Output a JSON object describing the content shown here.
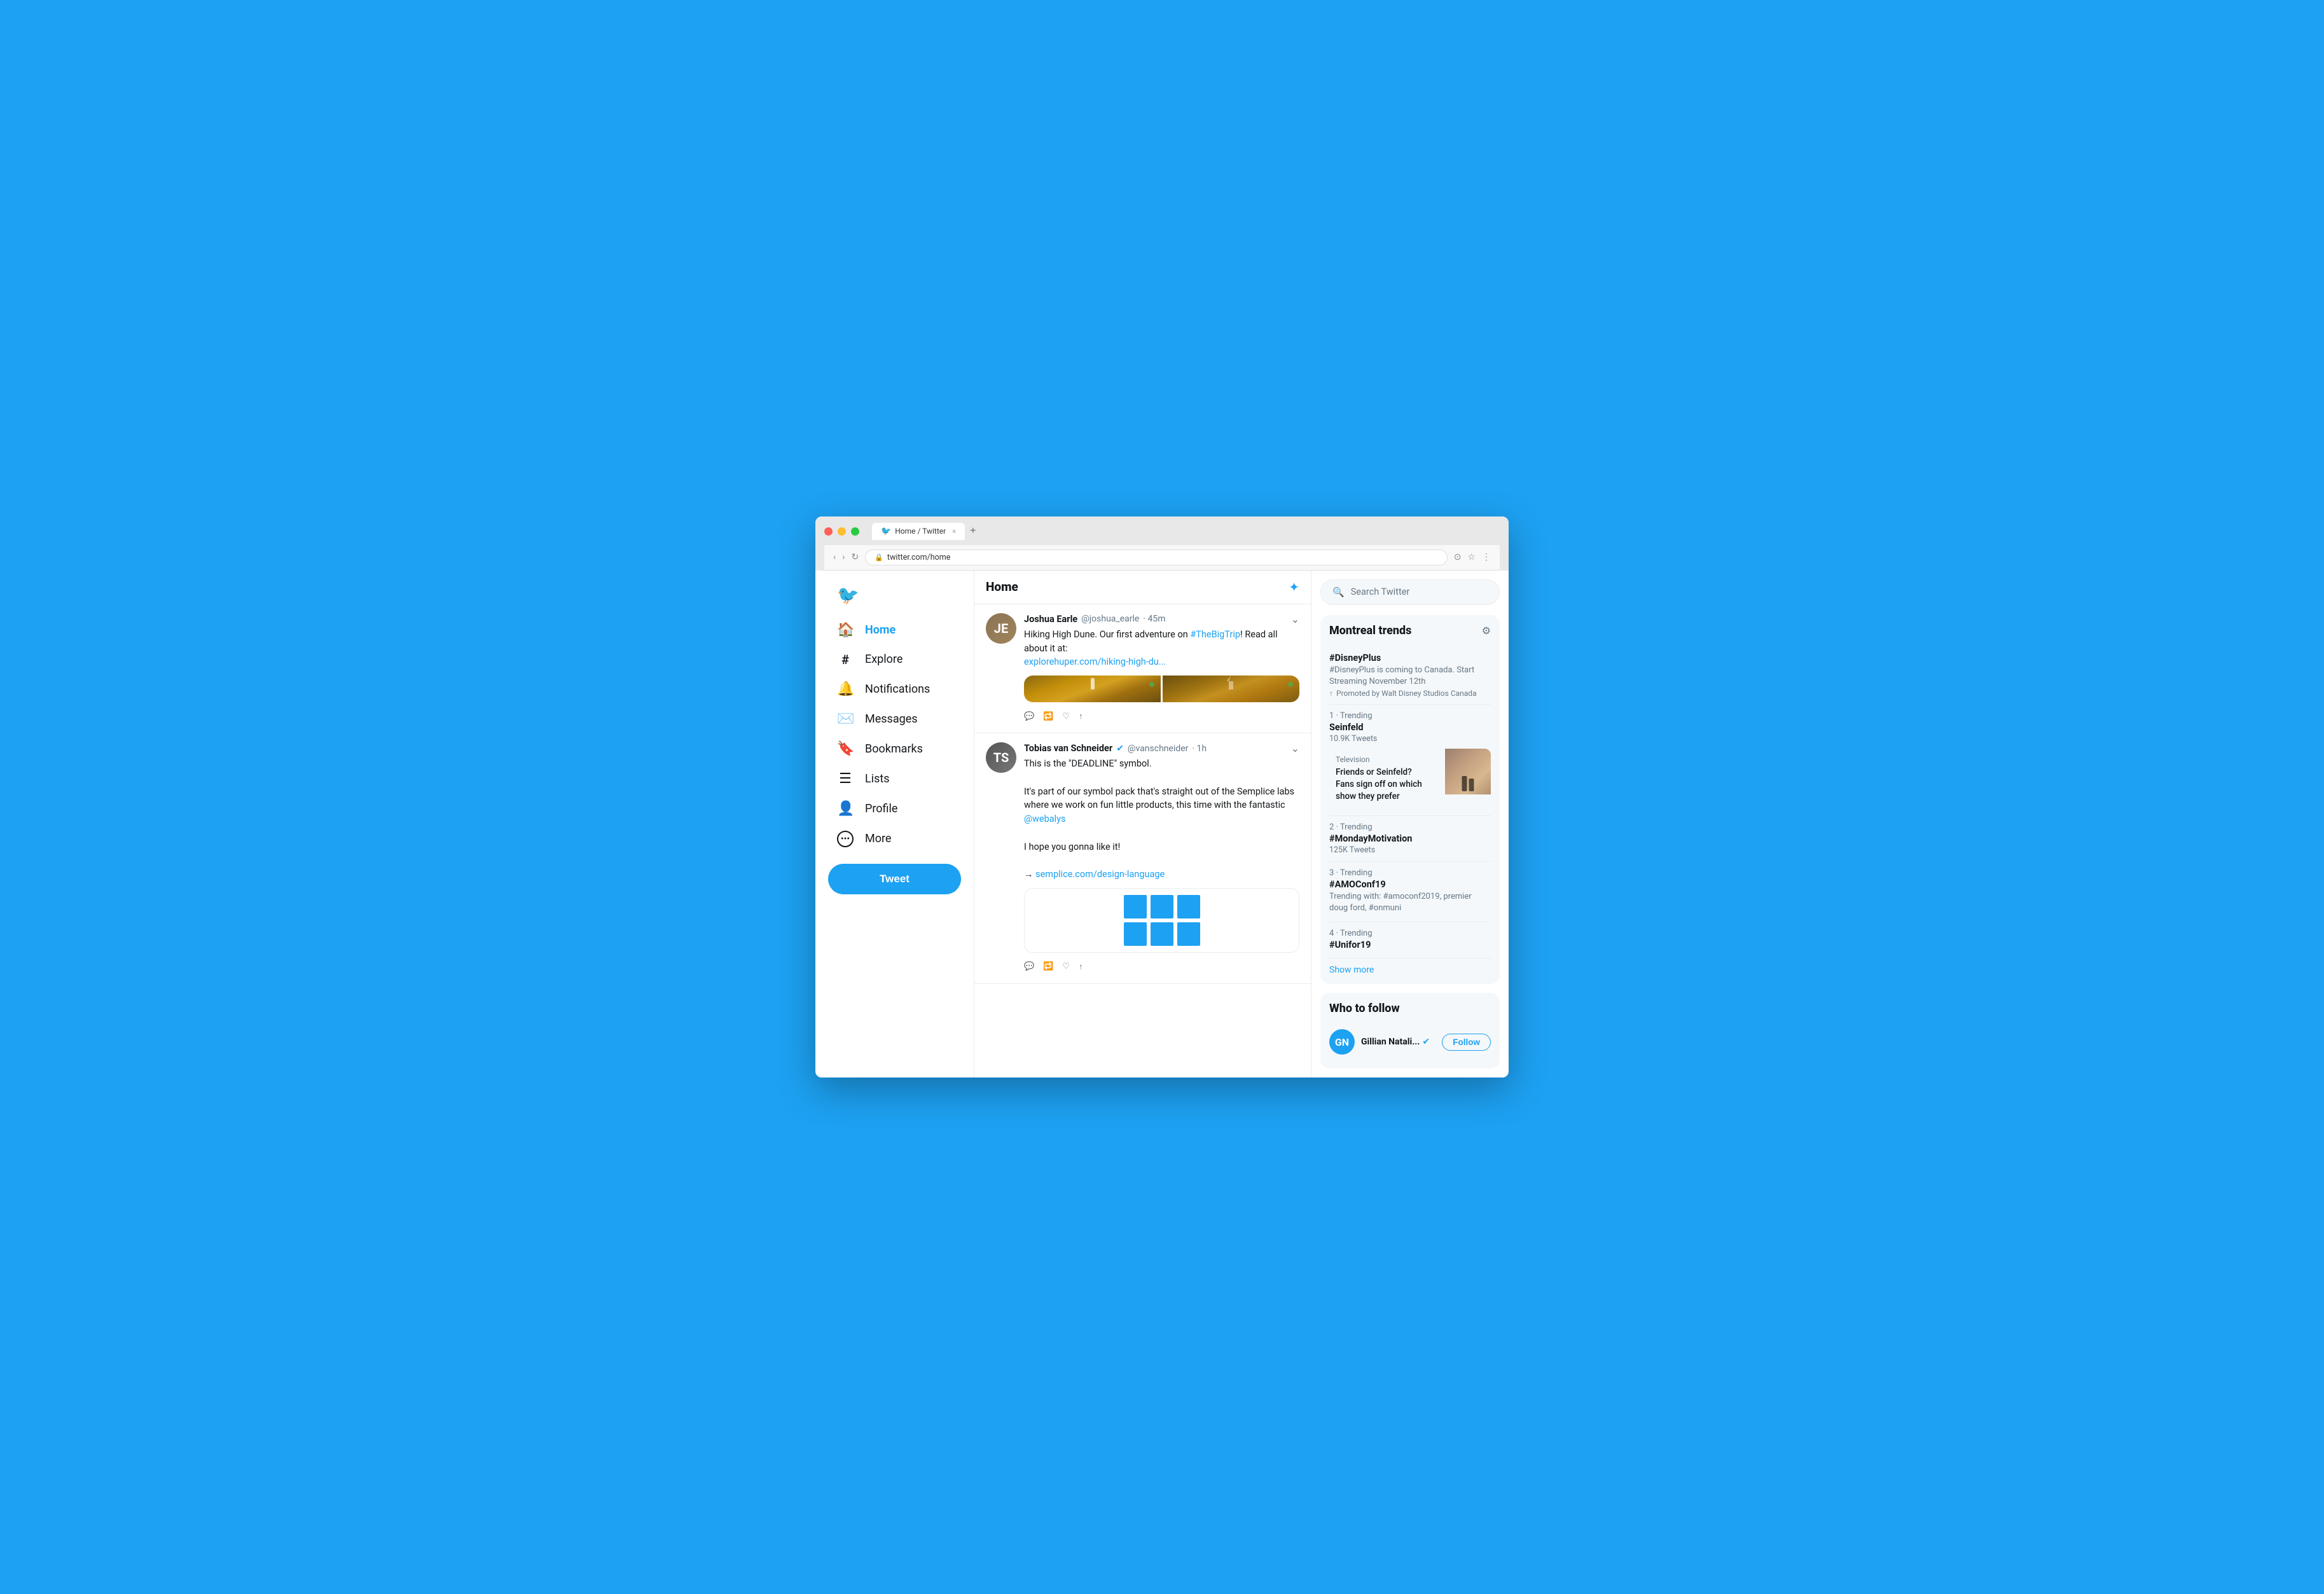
{
  "browser": {
    "traffic_lights": [
      "red",
      "yellow",
      "green"
    ],
    "tab_title": "Home / Twitter",
    "tab_favicon": "🐦",
    "tab_close": "×",
    "tab_new": "+",
    "nav_back": "‹",
    "nav_forward": "›",
    "nav_refresh": "↻",
    "address_lock": "🔒",
    "address_url": "twitter.com/home",
    "browser_icons": [
      "⊙",
      "☆",
      "⋮"
    ]
  },
  "sidebar": {
    "logo": "🐦",
    "nav_items": [
      {
        "id": "home",
        "icon": "🏠",
        "label": "Home",
        "active": true
      },
      {
        "id": "explore",
        "icon": "#",
        "label": "Explore",
        "active": false
      },
      {
        "id": "notifications",
        "icon": "🔔",
        "label": "Notifications",
        "active": false
      },
      {
        "id": "messages",
        "icon": "✉️",
        "label": "Messages",
        "active": false
      },
      {
        "id": "bookmarks",
        "icon": "🔖",
        "label": "Bookmarks",
        "active": false
      },
      {
        "id": "lists",
        "icon": "☰",
        "label": "Lists",
        "active": false
      },
      {
        "id": "profile",
        "icon": "👤",
        "label": "Profile",
        "active": false
      },
      {
        "id": "more",
        "icon": "⋯",
        "label": "More",
        "active": false
      }
    ],
    "tweet_button": "Tweet"
  },
  "feed": {
    "title": "Home",
    "sparkle_icon": "✦",
    "tweets": [
      {
        "id": "tweet1",
        "avatar_color": "#8B7355",
        "avatar_initials": "JE",
        "name": "Joshua Earle",
        "handle": "@joshua_earle",
        "time": "45m",
        "text": "Hiking High Dune. Our first adventure on ",
        "hashtag": "#TheBigTrip",
        "text2": "! Read all about it at:",
        "link": "explorehuper.com/hiking-high-du...",
        "has_images": true,
        "caret": "⌄",
        "actions": {
          "comment_icon": "💬",
          "retweet_icon": "🔁",
          "like_icon": "♡",
          "share_icon": "↑"
        }
      },
      {
        "id": "tweet2",
        "avatar_color": "#555",
        "avatar_initials": "TS",
        "name": "Tobias van Schneider",
        "verified": true,
        "handle": "@vanschneider",
        "time": "1h",
        "text1": "This is the \"DEADLINE\" symbol.",
        "text2": "It's part of our symbol pack that's straight out of the Semplice labs where we work on fun little products, this time with the fantastic ",
        "mention": "@webalys",
        "text3": "I hope you gonna like it!",
        "arrow": "→",
        "card_link": "semplice.com/design-language",
        "caret": "⌄",
        "actions": {
          "comment_icon": "💬",
          "retweet_icon": "🔁",
          "like_icon": "♡",
          "share_icon": "↑"
        }
      }
    ]
  },
  "right_sidebar": {
    "search_placeholder": "Search Twitter",
    "search_icon": "🔍",
    "trends": {
      "title": "Montreal trends",
      "gear_icon": "⚙",
      "items": [
        {
          "id": "trend-disneyplus",
          "hashtag": "#DisneyPlus",
          "desc": "#DisneyPlus is coming to Canada. Start Streaming November 12th",
          "promoted": true,
          "promoted_icon": "↑",
          "promoted_text": "Promoted by Walt Disney Studios Canada"
        },
        {
          "id": "trend-seinfeld",
          "number": "1 · Trending",
          "hashtag": "Seinfeld",
          "meta": "10.9K Tweets",
          "has_card": true,
          "card": {
            "category": "Television",
            "headline": "Friends or Seinfeld? Fans sign off on which show they prefer"
          }
        },
        {
          "id": "trend-monday",
          "number": "2 · Trending",
          "hashtag": "#MondayMotivation",
          "meta": "125K Tweets"
        },
        {
          "id": "trend-amoconf",
          "number": "3 · Trending",
          "hashtag": "#AMOConf19",
          "desc": "Trending with: #amoconf2019, premier doug ford, #onmuni"
        },
        {
          "id": "trend-unifor",
          "number": "4 · Trending",
          "hashtag": "#Unifor19"
        }
      ],
      "show_more": "Show more"
    },
    "who_to_follow": {
      "title": "Who to follow",
      "items": [
        {
          "id": "follow1",
          "avatar_color": "#1da1f2",
          "initials": "GN",
          "name": "Gillian Natali...",
          "verified": true,
          "follow_label": "Follow"
        }
      ]
    }
  }
}
